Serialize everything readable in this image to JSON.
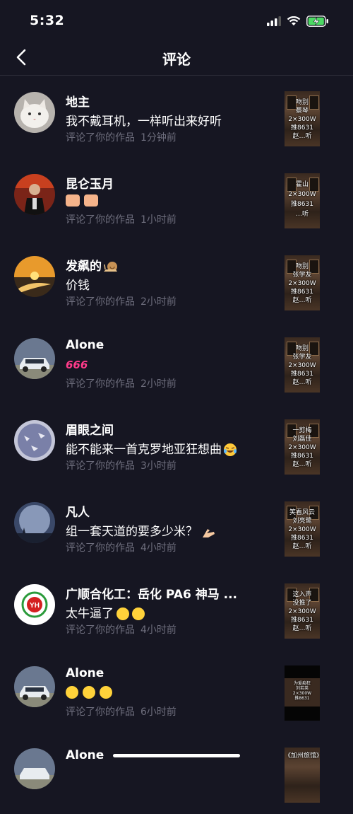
{
  "status": {
    "time": "5:32"
  },
  "header": {
    "title": "评论"
  },
  "comments": [
    {
      "name": "地主",
      "content": "我不戴耳机，一样听出来好听",
      "action": "评论了你的作品",
      "time": "1分钟前",
      "thumb": [
        "吻别",
        "蔡琴",
        "2×300W",
        "推8631",
        "赵…听"
      ],
      "avatar_color": "#e8e4e0"
    },
    {
      "name": "昆仑玉月",
      "content": "",
      "emoji": "thumbs-up-x2",
      "action": "评论了你的作品",
      "time": "1小时前",
      "thumb": [
        "霍山",
        "2×300W",
        "推8631",
        "…听"
      ],
      "avatar_color": "#8a2a1a"
    },
    {
      "name": "发飙的",
      "content": "价钱",
      "action": "评论了你的作品",
      "time": "2小时前",
      "thumb": [
        "吻别",
        "张学友",
        "2×300W",
        "推8631",
        "赵…听"
      ],
      "avatar_color": "#d98a2a"
    },
    {
      "name": "Alone",
      "content": "666",
      "action": "评论了你的作品",
      "time": "2小时前",
      "thumb": [
        "吻别",
        "张学友",
        "2×300W",
        "推8631",
        "赵…听"
      ],
      "avatar_color": "#5a6a80"
    },
    {
      "name": "眉眼之间",
      "content": "能不能来一首克罗地亚狂想曲",
      "action": "评论了你的作品",
      "time": "3小时前",
      "thumb": [
        "一剪梅",
        "刘磊佳",
        "2×300W",
        "推8631",
        "赵…听"
      ],
      "avatar_color": "#7a82a8"
    },
    {
      "name": "凡人",
      "content": "组一套天道的要多少米？",
      "action": "评论了你的作品",
      "time": "4小时前",
      "thumb": [
        "笑看风云",
        "刘亮鹭",
        "2×300W",
        "推8631",
        "赵…听"
      ],
      "avatar_color": "#4a5a7a"
    },
    {
      "name": "广顺合化工：岳化 PA6   神马 ...",
      "content": "太牛逼了",
      "action": "评论了你的作品",
      "time": "4小时前",
      "thumb": [
        "这入声",
        "没推了",
        "2×300W",
        "推8631",
        "赵…听"
      ],
      "avatar_color": "#ffffff"
    },
    {
      "name": "Alone",
      "content": "",
      "emoji": "faces-x3",
      "action": "评论了你的作品",
      "time": "6小时前",
      "thumb": [
        "为爱痴狂",
        "刘若英",
        "2×300W",
        "推8631"
      ],
      "avatar_color": "#5a6a80"
    },
    {
      "name": "Alone",
      "content": "",
      "action": "",
      "time": "",
      "thumb": [
        "《加州旅馆》"
      ],
      "avatar_color": "#5a6a80"
    }
  ]
}
